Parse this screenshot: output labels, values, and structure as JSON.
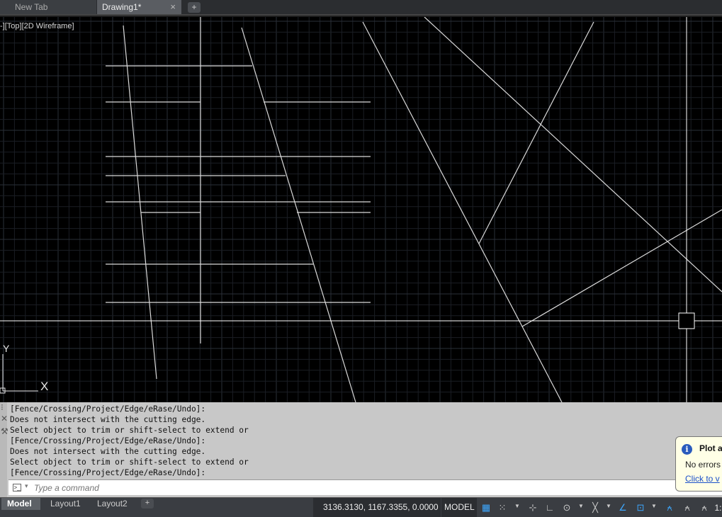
{
  "tabs": {
    "new_tab": "New Tab",
    "drawing": "Drawing1*",
    "close": "×",
    "add": "+"
  },
  "viewport": {
    "label": "-][Top][2D Wireframe]",
    "ucs_x": "X",
    "ucs_y": "Y"
  },
  "command": {
    "history": [
      "[Fence/Crossing/Project/Edge/eRase/Undo]:",
      "Does not intersect with the cutting edge.",
      "Select object to trim or shift-select to extend or",
      "[Fence/Crossing/Project/Edge/eRase/Undo]:",
      "Does not intersect with the cutting edge.",
      "Select object to trim or shift-select to extend or",
      "[Fence/Crossing/Project/Edge/eRase/Undo]:"
    ],
    "placeholder": "Type a command"
  },
  "balloon": {
    "title": "Plot a",
    "message": "No errors",
    "link": "Click to v"
  },
  "status": {
    "layouts": [
      "Model",
      "Layout1",
      "Layout2"
    ],
    "add": "+",
    "coordinates": "3136.3130, 1167.3355, 0.0000",
    "space": "MODEL",
    "scale": "1:"
  },
  "icons": {
    "grid": "grid-icon",
    "snap": "snap-icon",
    "ortho": "ortho-icon",
    "polar": "polar-tracking-icon",
    "isodraft": "isodraft-icon",
    "osnap": "object-snap-icon",
    "lineweight": "lineweight-icon",
    "annotation": "annotation-scale-icon"
  },
  "colors": {
    "viewport_bg": "#000000",
    "grid_minor": "#1b1e24",
    "grid_major": "#2a2f38",
    "line": "#d9d9d9",
    "cmd_bg": "#c8c8c8",
    "accent": "#3da8ff"
  }
}
